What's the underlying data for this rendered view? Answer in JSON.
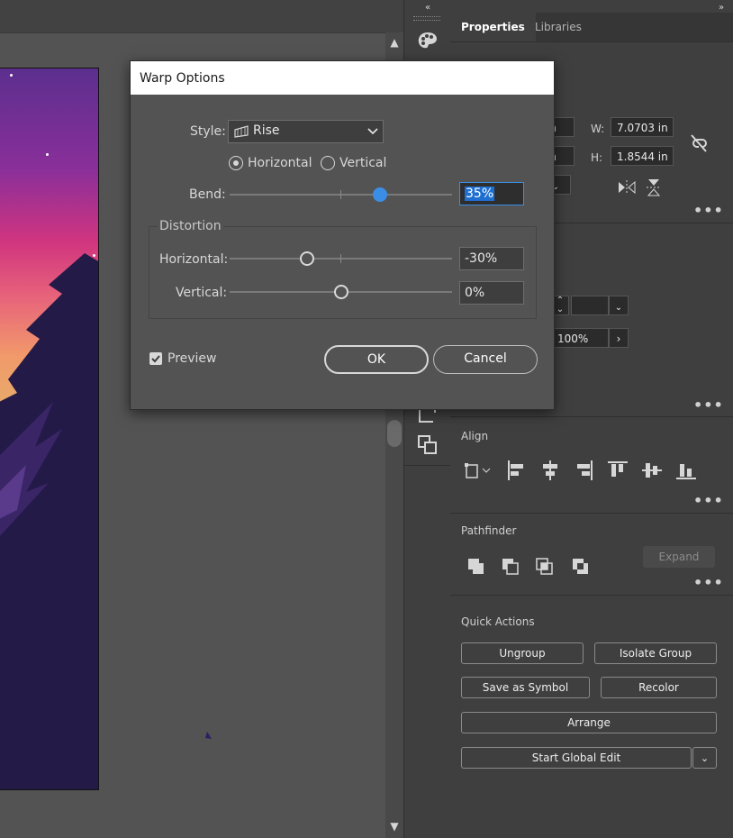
{
  "panel": {
    "tabs": [
      {
        "label": "Properties"
      },
      {
        "label": "Libraries"
      }
    ],
    "transform": {
      "x_unit": "in",
      "y_unit": "in",
      "w_label": "W:",
      "w_value": "7.0703 in",
      "h_label": "H:",
      "h_value": "1.8544 in"
    },
    "appearance": {
      "opacity_value": "100%"
    },
    "align": {
      "title": "Align"
    },
    "pathfinder": {
      "title": "Pathfinder",
      "expand_label": "Expand"
    },
    "quick_actions": {
      "title": "Quick Actions",
      "ungroup": "Ungroup",
      "isolate_group": "Isolate Group",
      "save_as_symbol": "Save as Symbol",
      "recolor": "Recolor",
      "arrange": "Arrange",
      "start_global_edit": "Start Global Edit"
    }
  },
  "dialog": {
    "title": "Warp Options",
    "style_label": "Style:",
    "style_value": "Rise",
    "orientation_horizontal": "Horizontal",
    "orientation_vertical": "Vertical",
    "orientation_selected": "horizontal",
    "bend_label": "Bend:",
    "bend_value": "35%",
    "bend_level": 35,
    "distortion_title": "Distortion",
    "horizontal_label": "Horizontal:",
    "horizontal_value": "-30%",
    "horizontal_level": -30,
    "vertical_label": "Vertical:",
    "vertical_value": "0%",
    "vertical_level": 0,
    "preview_label": "Preview",
    "preview_checked": true,
    "ok_label": "OK",
    "cancel_label": "Cancel"
  },
  "colors": {
    "accent": "#3b8ee6",
    "selection": "#1f6fd0"
  }
}
